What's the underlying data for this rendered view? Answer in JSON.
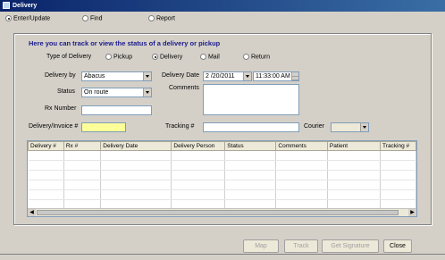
{
  "window": {
    "title": "Delivery"
  },
  "modes": [
    {
      "label": "Enter/Update",
      "selected": true
    },
    {
      "label": "Find",
      "selected": false
    },
    {
      "label": "Report",
      "selected": false
    }
  ],
  "form": {
    "heading": "Here you can track or view the status of a delivery or pickup",
    "type_label": "Type of Delivery",
    "types": [
      {
        "label": "Pickup",
        "selected": false
      },
      {
        "label": "Delivery",
        "selected": true
      },
      {
        "label": "Mail",
        "selected": false
      },
      {
        "label": "Return",
        "selected": false
      }
    ],
    "delivery_by_label": "Delivery by",
    "delivery_by_value": "Abacus",
    "status_label": "Status",
    "status_value": "On route",
    "rx_label": "Rx Number",
    "rx_value": "",
    "invoice_label": "Delivery/Invoice #",
    "invoice_value": "",
    "date_label": "Delivery Date",
    "date_value": "2 /20/2011",
    "time_value": "11:33:00 AM",
    "comments_label": "Comments",
    "comments_value": "",
    "tracking_label": "Tracking #",
    "tracking_value": "",
    "courier_label": "Courier",
    "courier_value": ""
  },
  "grid": {
    "columns": [
      "Delivery #",
      "Rx #",
      "Delivery Date",
      "Delivery Person",
      "Status",
      "Comments",
      "Patient",
      "Tracking #"
    ]
  },
  "buttons": {
    "map": "Map",
    "track": "Track",
    "get_signature": "Get Signature",
    "close": "Close"
  }
}
